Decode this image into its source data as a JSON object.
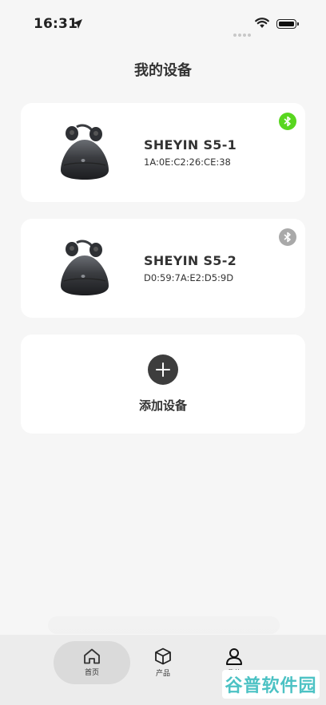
{
  "status_bar": {
    "time": "16:31"
  },
  "page": {
    "title": "我的设备"
  },
  "devices": [
    {
      "name": "SHEYIN S5-1",
      "mac": "1A:0E:C2:26:CE:38",
      "bluetooth": "connected",
      "bluetooth_color": "#58d61f"
    },
    {
      "name": "SHEYIN S5-2",
      "mac": "D0:59:7A:E2:D5:9D",
      "bluetooth": "disconnected",
      "bluetooth_color": "#a9a9a9"
    }
  ],
  "add_device": {
    "label": "添加设备"
  },
  "tabs": [
    {
      "label": "首页",
      "icon": "home-icon",
      "selected": true
    },
    {
      "label": "产品",
      "icon": "cube-icon",
      "selected": false
    },
    {
      "label": "我的",
      "icon": "person-icon",
      "selected": false
    }
  ],
  "watermark": {
    "text": "谷普软件园"
  }
}
